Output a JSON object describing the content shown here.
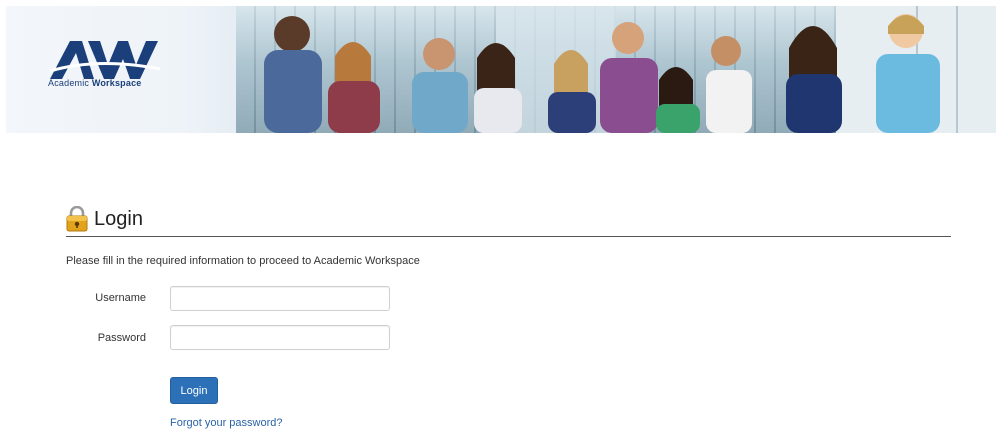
{
  "banner": {
    "logo_letters": "AW",
    "logo_sub_prefix": "Academic",
    "logo_sub_bold": "Workspace",
    "colors": {
      "brand_blue": "#1b3f7a"
    }
  },
  "login": {
    "title": "Login",
    "lock_icon": "lock-icon",
    "instructions": "Please fill in the required information to proceed to Academic Workspace",
    "username_label": "Username",
    "username_value": "",
    "password_label": "Password",
    "password_value": "",
    "button_label": "Login",
    "forgot_link": "Forgot your password?",
    "colors": {
      "button": "#2c71b8",
      "link": "#2a63a8"
    }
  }
}
